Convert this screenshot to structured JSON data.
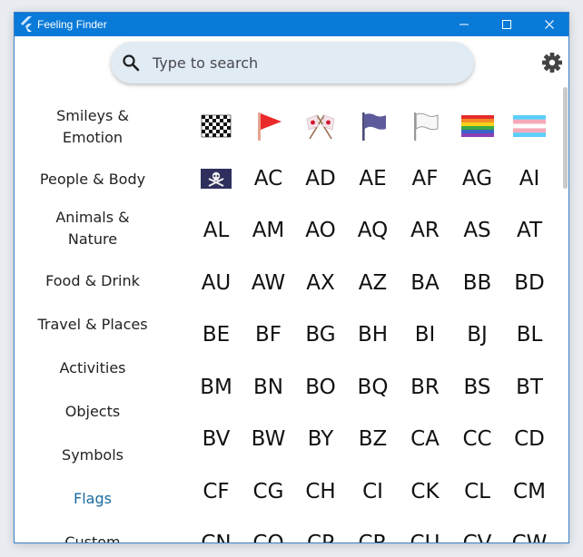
{
  "window": {
    "title": "Feeling Finder",
    "accent": "#0a7ad8"
  },
  "search": {
    "placeholder": "Type to search"
  },
  "sidebar": {
    "items": [
      {
        "label": "Smileys & Emotion",
        "lines": [
          "Smileys &",
          "Emotion"
        ]
      },
      {
        "label": "People & Body",
        "lines": [
          "People & Body"
        ]
      },
      {
        "label": "Animals & Nature",
        "lines": [
          "Animals &",
          "Nature"
        ]
      },
      {
        "label": "Food & Drink",
        "lines": [
          "Food & Drink"
        ]
      },
      {
        "label": "Travel & Places",
        "lines": [
          "Travel & Places"
        ]
      },
      {
        "label": "Activities",
        "lines": [
          "Activities"
        ]
      },
      {
        "label": "Objects",
        "lines": [
          "Objects"
        ]
      },
      {
        "label": "Symbols",
        "lines": [
          "Symbols"
        ]
      },
      {
        "label": "Flags",
        "lines": [
          "Flags"
        ]
      },
      {
        "label": "Custom",
        "lines": [
          "Custom"
        ]
      }
    ],
    "active": "Flags",
    "active_color": "#1a6aa0"
  },
  "grid": {
    "icons": [
      "chequered-flag-icon",
      "triangular-flag-icon",
      "crossed-flags-icon",
      "black-flag-icon",
      "white-flag-icon",
      "rainbow-flag-icon",
      "transgender-flag-icon",
      "pirate-flag-icon"
    ],
    "codes": [
      "AC",
      "AD",
      "AE",
      "AF",
      "AG",
      "AI",
      "AL",
      "AM",
      "AO",
      "AQ",
      "AR",
      "AS",
      "AT",
      "AU",
      "AW",
      "AX",
      "AZ",
      "BA",
      "BB",
      "BD",
      "BE",
      "BF",
      "BG",
      "BH",
      "BI",
      "BJ",
      "BL",
      "BM",
      "BN",
      "BO",
      "BQ",
      "BR",
      "BS",
      "BT",
      "BV",
      "BW",
      "BY",
      "BZ",
      "CA",
      "CC",
      "CD",
      "CF",
      "CG",
      "CH",
      "CI",
      "CK",
      "CL",
      "CM",
      "CN",
      "CO",
      "CP",
      "CR",
      "CU",
      "CV",
      "CW"
    ]
  }
}
